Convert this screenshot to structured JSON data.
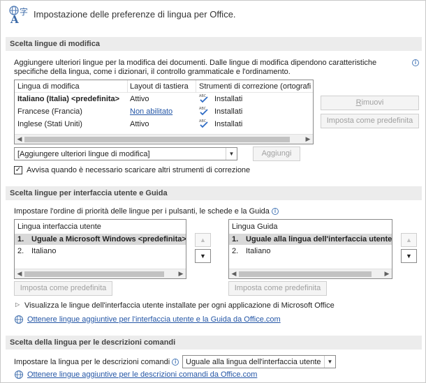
{
  "header": {
    "title": "Impostazione delle preferenze di lingua per Office.",
    "icon": "language-icon"
  },
  "editing": {
    "section_title": "Scelta lingue di modifica",
    "description_line1": "Aggiungere ulteriori lingue per la modifica dei documenti. Dalle lingue di modifica dipendono caratteristiche",
    "description_line2": "specifiche della lingua, come i dizionari, il controllo grammaticale e l'ordinamento.",
    "columns": [
      "Lingua di modifica",
      "Layout di tastiera",
      "Strumenti di correzione (ortografi"
    ],
    "rows": [
      {
        "language": "Italiano (Italia) <predefinita>",
        "keyboard": "Attivo",
        "proofing": "Installati"
      },
      {
        "language": "Francese (Francia)",
        "keyboard": "Non abilitato",
        "proofing": "Installati"
      },
      {
        "language": "Inglese (Stati Uniti)",
        "keyboard": "Attivo",
        "proofing": "Installati"
      }
    ],
    "remove_button": "Rimuovi",
    "set_default_button": "Imposta come predefinita",
    "add_select_value": "[Aggiungere ulteriori lingue di modifica]",
    "add_button": "Aggiungi",
    "notify_checkbox_label": "Avvisa quando è necessario scaricare altri strumenti di correzione",
    "notify_checked": true
  },
  "ui_languages": {
    "section_title": "Scelta lingue per interfaccia utente e Guida",
    "description": "Impostare l'ordine di priorità delle lingue per i pulsanti, le schede e la Guida",
    "display_list": {
      "header": "Lingua interfaccia utente",
      "items": [
        {
          "num": "1.",
          "label": "Uguale a Microsoft Windows <predefinita>"
        },
        {
          "num": "2.",
          "label": "Italiano"
        }
      ],
      "set_default_button": "Imposta come predefinita"
    },
    "help_list": {
      "header": "Lingua Guida",
      "items": [
        {
          "num": "1.",
          "label": "Uguale alla lingua dell'interfaccia utente"
        },
        {
          "num": "2.",
          "label": "Italiano"
        }
      ],
      "set_default_button": "Imposta come predefinita"
    },
    "expand_label": "Visualizza le lingue dell'interfaccia utente installate per ogni applicazione di Microsoft Office",
    "link": "Ottenere lingue aggiuntive per l'interfaccia utente e la Guida da Office.com"
  },
  "tooltips": {
    "section_title": "Scelta della lingua per le descrizioni comandi",
    "label": "Impostare la lingua per le descrizioni comandi",
    "select_value": "Uguale alla lingua dell'interfaccia utente",
    "link": "Ottenere lingue aggiuntive per le descrizioni comandi da Office.com"
  },
  "colors": {
    "link": "#2456a6",
    "section_bg": "#ececec",
    "selection": "#d9d9d9"
  }
}
